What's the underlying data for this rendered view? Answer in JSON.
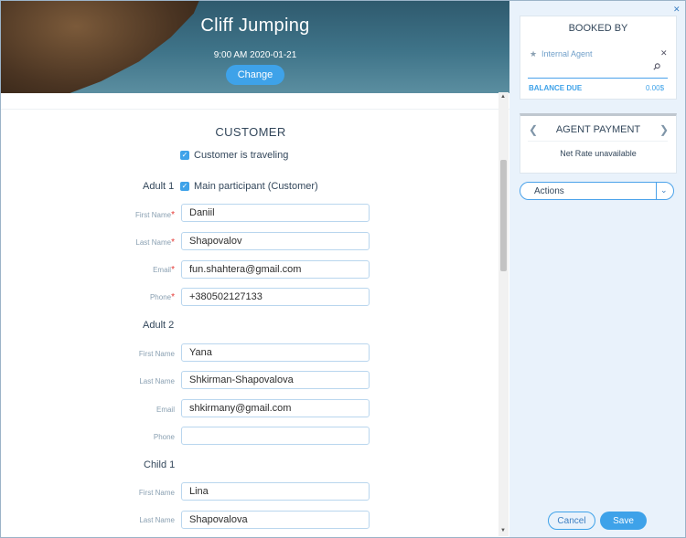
{
  "header": {
    "title": "Cliff Jumping",
    "datetime": "9:00 AM 2020-01-21",
    "change_label": "Change"
  },
  "customer": {
    "section_title": "CUSTOMER",
    "traveling_label": "Customer is traveling",
    "main_participant_label": "Main participant (Customer)",
    "participants": [
      {
        "heading": "Adult 1",
        "fields": [
          {
            "label": "First Name",
            "required": true,
            "value": "Daniil"
          },
          {
            "label": "Last Name",
            "required": true,
            "value": "Shapovalov"
          },
          {
            "label": "Email",
            "required": true,
            "value": "fun.shahtera@gmail.com"
          },
          {
            "label": "Phone",
            "required": true,
            "value": "+380502127133"
          }
        ]
      },
      {
        "heading": "Adult 2",
        "fields": [
          {
            "label": "First Name",
            "required": false,
            "value": "Yana"
          },
          {
            "label": "Last Name",
            "required": false,
            "value": "Shkirman-Shapovalova"
          },
          {
            "label": "Email",
            "required": false,
            "value": "shkirmany@gmail.com"
          },
          {
            "label": "Phone",
            "required": false,
            "value": ""
          }
        ]
      },
      {
        "heading": "Child 1",
        "fields": [
          {
            "label": "First Name",
            "required": false,
            "value": "Lina"
          },
          {
            "label": "Last Name",
            "required": false,
            "value": "Shapovalova"
          }
        ]
      }
    ]
  },
  "booked_by": {
    "title": "BOOKED BY",
    "agent_placeholder": "Internal Agent",
    "balance_label": "BALANCE DUE",
    "balance_value": "0.00$"
  },
  "agent_payment": {
    "title": "AGENT PAYMENT",
    "note": "Net Rate unavailable"
  },
  "actions_label": "Actions",
  "footer": {
    "cancel_label": "Cancel",
    "save_label": "Save"
  },
  "icons": {
    "close": "close-icon",
    "star": "star-icon",
    "search": "search-icon",
    "checkbox": "check-icon"
  },
  "colors": {
    "accent": "#3ea2e9",
    "required": "#e53935",
    "panel_bg": "#e9f2fb"
  }
}
